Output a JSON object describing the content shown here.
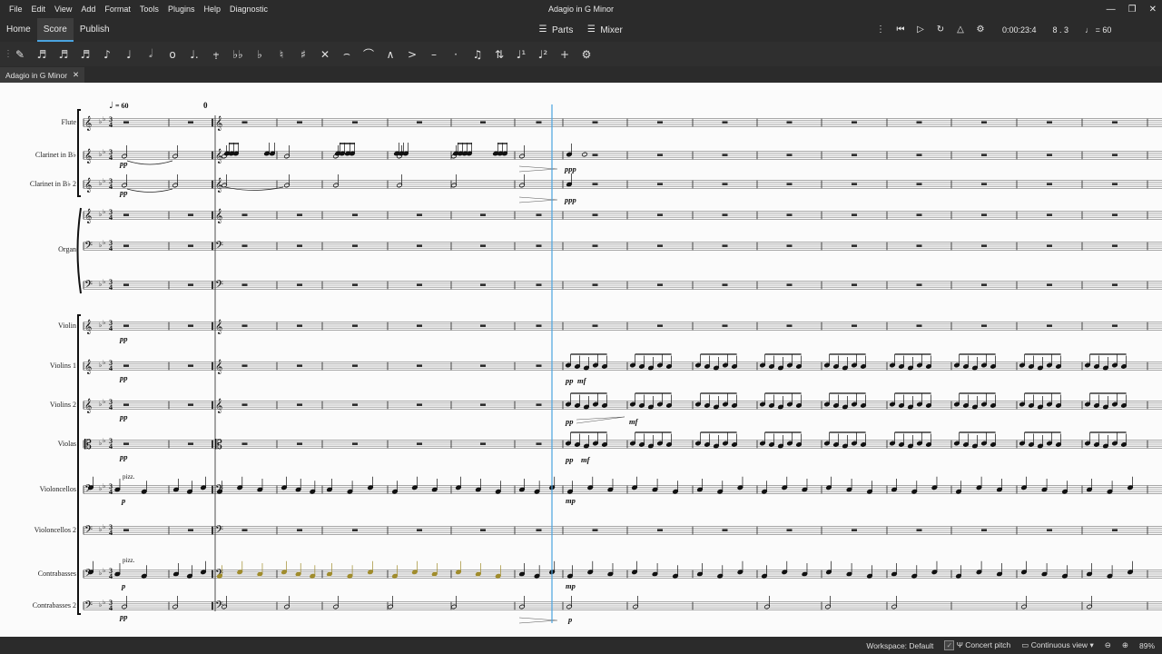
{
  "menubar": {
    "items": [
      "File",
      "Edit",
      "View",
      "Add",
      "Format",
      "Tools",
      "Plugins",
      "Help",
      "Diagnostic"
    ],
    "window_title": "Adagio in G Minor"
  },
  "tabs": {
    "home": "Home",
    "score": "Score",
    "publish": "Publish",
    "parts": "Parts",
    "mixer": "Mixer"
  },
  "playback": {
    "time": "0:00:23:4",
    "position": "8 . 3",
    "tempo": "= 60"
  },
  "toolbar": {
    "icons": [
      "pencil-icon",
      "sixty-fourth-note-icon",
      "thirty-second-note-icon",
      "sixteenth-note-icon",
      "eighth-note-icon",
      "quarter-note-icon",
      "half-note-icon",
      "whole-note-icon",
      "augmentation-dot-icon",
      "rest-icon",
      "double-flat-icon",
      "flat-icon",
      "natural-icon",
      "sharp-icon",
      "double-sharp-icon",
      "tie-icon",
      "slur-icon",
      "marcato-icon",
      "accent-icon",
      "tenuto-icon",
      "staccato-icon",
      "tuplet-icon",
      "flip-direction-icon",
      "voice-1-icon",
      "voice-2-icon",
      "add-icon",
      "settings-icon"
    ]
  },
  "document": {
    "tab_label": "Adagio in G Minor"
  },
  "score": {
    "tempo_mark": "= 60",
    "rehearsal": "0",
    "instruments": [
      "Flute",
      "Clarinet in B♭",
      "Clarinet in B♭ 2",
      "Organ",
      "Violin",
      "Violins 1",
      "Violins 2",
      "Violas",
      "Violoncellos",
      "Violoncellos 2",
      "Contrabasses",
      "Contrabasses 2"
    ],
    "dynamics": {
      "pp": "pp",
      "ppp": "ppp",
      "mp": "mp",
      "mf": "mf",
      "p": "p",
      "pizz": "pizz."
    }
  },
  "statusbar": {
    "workspace": "Workspace: Default",
    "concert_pitch": "Concert pitch",
    "view_mode": "Continuous view",
    "zoom": "89%"
  },
  "colors": {
    "chrome": "#2b2b2b",
    "accent": "#4aa3df",
    "paper": "#fbfbfb",
    "selection": "#a08c2c"
  }
}
